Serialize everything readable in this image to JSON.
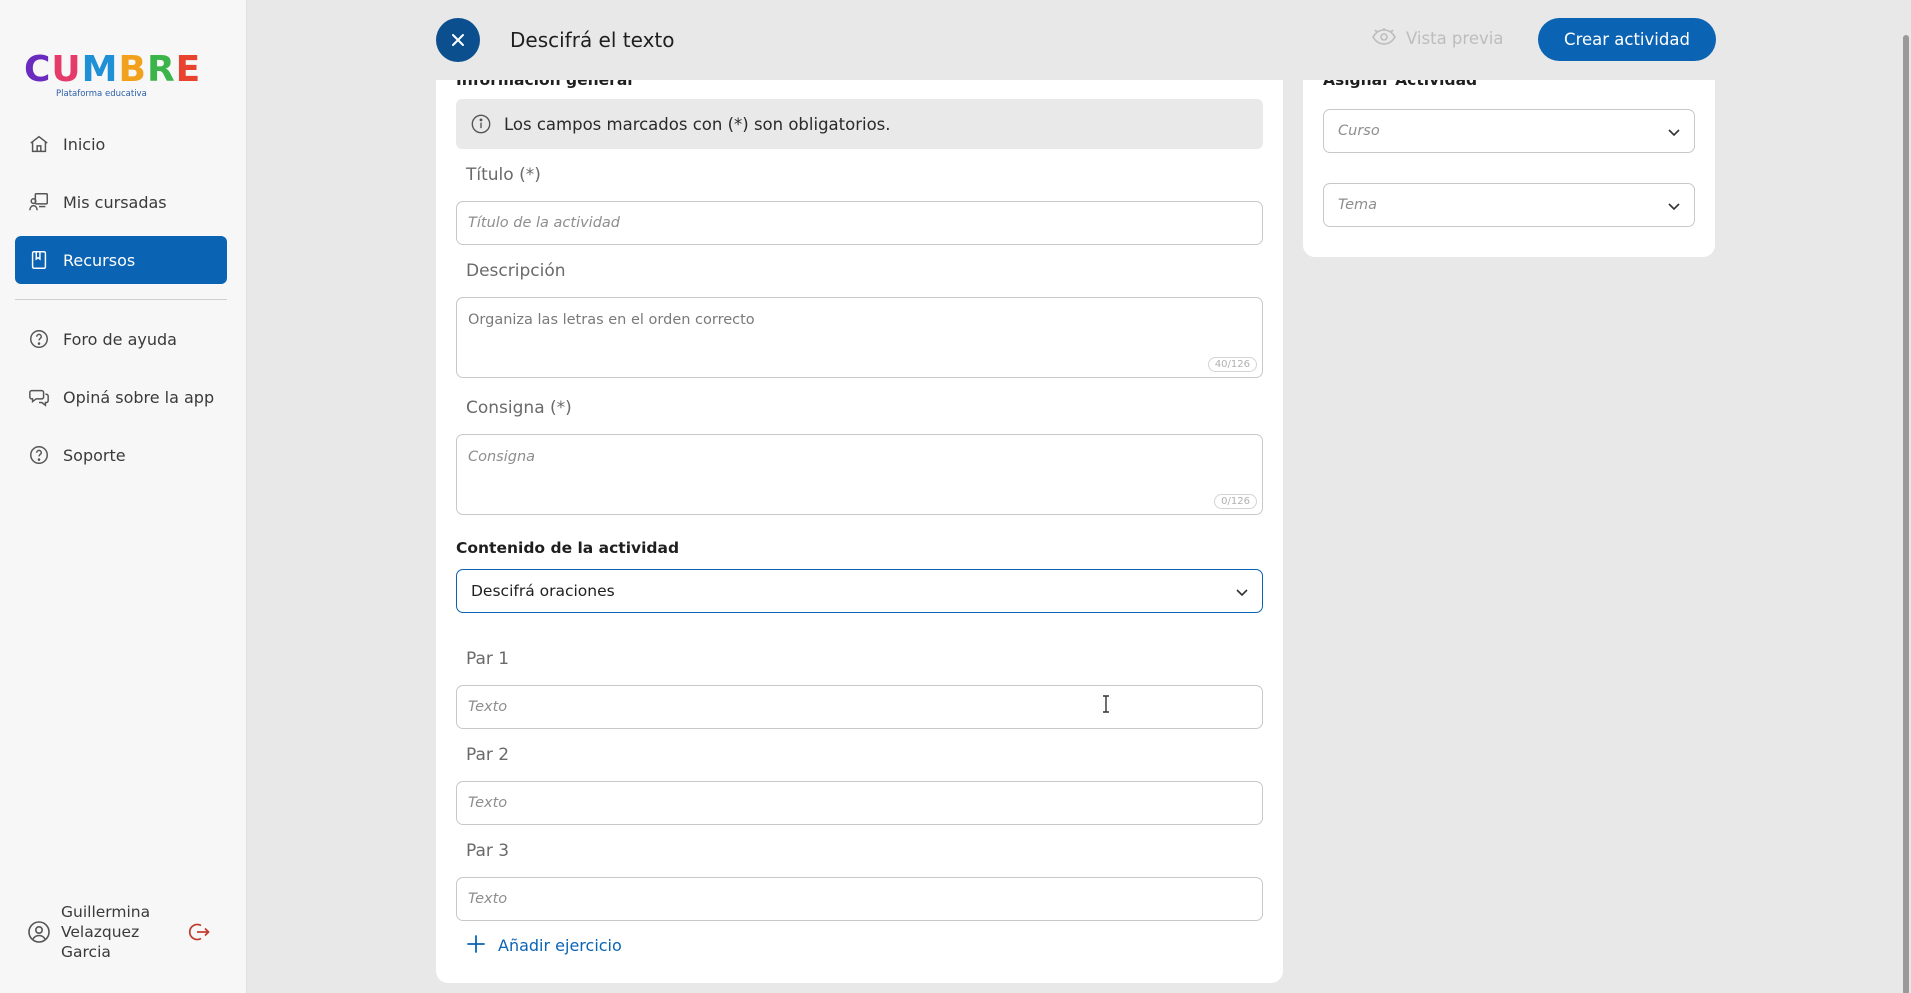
{
  "brand": {
    "logo_letters": [
      "C",
      "U",
      "M",
      "B",
      "R",
      "E"
    ],
    "logo_colors": [
      "#6a2bbf",
      "#e53b6b",
      "#1f8fd6",
      "#f2a11c",
      "#3bb54a",
      "#e8432e"
    ],
    "tagline": "Plataforma educativa"
  },
  "sidebar": {
    "items": [
      {
        "label": "Inicio",
        "icon": "home-icon"
      },
      {
        "label": "Mis cursadas",
        "icon": "teacher-board-icon"
      },
      {
        "label": "Recursos",
        "icon": "book-icon",
        "active": true
      },
      {
        "label": "Foro de ayuda",
        "icon": "help-circle-icon"
      },
      {
        "label": "Opiná sobre la app",
        "icon": "chat-bubbles-icon"
      },
      {
        "label": "Soporte",
        "icon": "help-circle-icon"
      }
    ],
    "user": {
      "name": "Guillermina Velazquez Garcia",
      "icon": "user-circle-icon",
      "logout_icon": "logout-icon"
    }
  },
  "header": {
    "title": "Descifrá el texto",
    "preview_label": "Vista previa",
    "create_label": "Crear actividad"
  },
  "form": {
    "section_general": "Información general",
    "info_text": "Los campos marcados con (*) son obligatorios.",
    "title_label": "Título (*)",
    "title_placeholder": "Título de la actividad",
    "description_label": "Descripción",
    "description_value": "Organiza las letras en el orden correcto",
    "description_counter": "40/126",
    "instruction_label": "Consigna (*)",
    "instruction_placeholder": "Consigna",
    "instruction_counter": "0/126",
    "content_label": "Contenido de la actividad",
    "content_value": "Descifrá oraciones",
    "pairs": [
      {
        "label": "Par 1",
        "placeholder": "Texto"
      },
      {
        "label": "Par 2",
        "placeholder": "Texto"
      },
      {
        "label": "Par 3",
        "placeholder": "Texto"
      }
    ],
    "add_exercise": "Añadir ejercicio"
  },
  "assign": {
    "section_title": "Asignar Actividad",
    "course_placeholder": "Curso",
    "topic_placeholder": "Tema"
  },
  "colors": {
    "primary": "#0b63b3",
    "close_button": "#0b4f8f"
  }
}
